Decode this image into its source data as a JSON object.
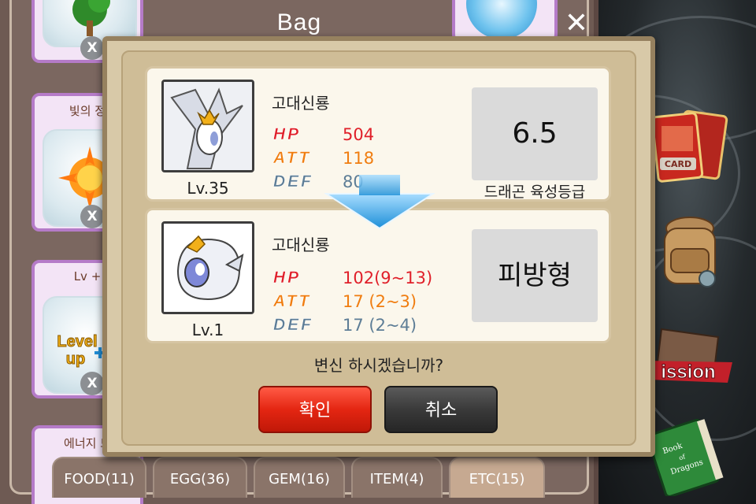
{
  "bag": {
    "title": "Bag",
    "close_glyph": "✕",
    "items": [
      {
        "name": "",
        "x": "X"
      },
      {
        "name": "빛의 정",
        "x": "X"
      },
      {
        "name": "Lv +",
        "x": "X",
        "art_text": [
          "Level",
          "up"
        ]
      },
      {
        "name": "에너지 드",
        "x": ""
      }
    ]
  },
  "tabs": [
    {
      "label": "FOOD(11)",
      "active": false
    },
    {
      "label": "EGG(36)",
      "active": false
    },
    {
      "label": "GEM(16)",
      "active": false
    },
    {
      "label": "ITEM(4)",
      "active": false
    },
    {
      "label": "ETC(15)",
      "active": true
    }
  ],
  "popup": {
    "current": {
      "name": "고대신룡",
      "level": "Lv.35",
      "stats": [
        {
          "label": "HP",
          "value": "504",
          "color": "#e0202a"
        },
        {
          "label": "ATT",
          "value": "118",
          "color": "#f07d10"
        },
        {
          "label": "DEF",
          "value": "80",
          "color": "#5d7d96"
        }
      ],
      "grade_value": "6.5",
      "grade_caption": "드래곤 육성등급"
    },
    "next": {
      "name": "고대신룡",
      "level": "Lv.1",
      "stats": [
        {
          "label": "HP",
          "value": "102(9~13)",
          "color": "#e0202a"
        },
        {
          "label": "ATT",
          "value": "17  (2~3)",
          "color": "#f07d10"
        },
        {
          "label": "DEF",
          "value": "17  (2~4)",
          "color": "#5d7d96"
        }
      ],
      "type_label": "피방형"
    },
    "question": "변신 하시겠습니까?",
    "confirm_label": "확인",
    "cancel_label": "취소"
  },
  "side_menu": {
    "card_label": "CARD",
    "mission_label": "ission",
    "book_label": [
      "Book",
      "of",
      "Dragons"
    ]
  },
  "icons": [
    "close-icon",
    "arrow-down-icon",
    "card-icon",
    "backpack-icon",
    "mission-icon",
    "book-icon"
  ]
}
